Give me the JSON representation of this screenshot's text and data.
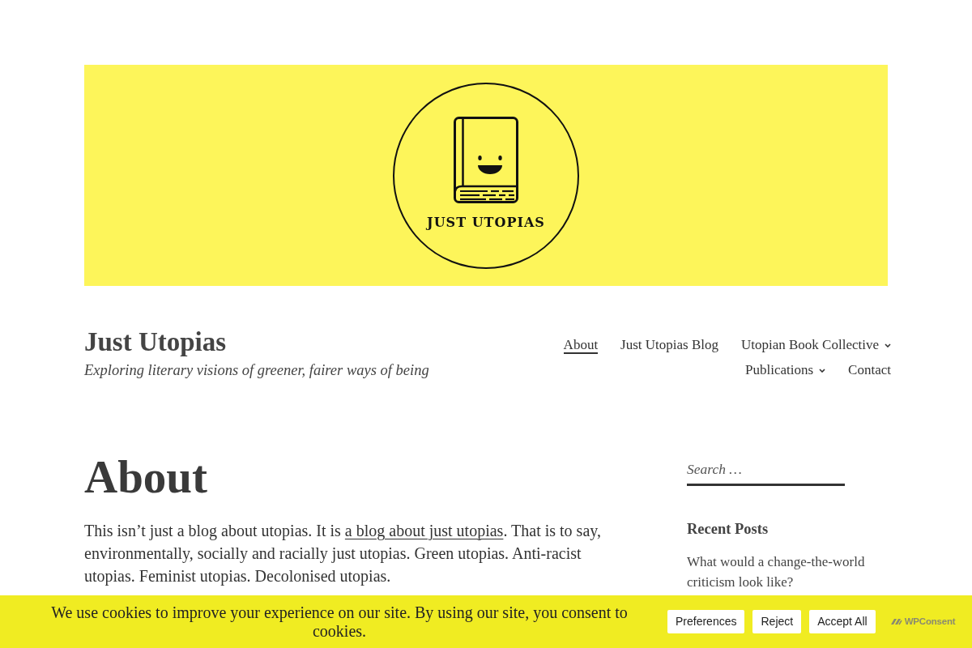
{
  "header_image": {
    "logo_text": "JUST UTOPIAS"
  },
  "site": {
    "title": "Just Utopias",
    "tagline": "Exploring literary visions of greener, fairer ways of being"
  },
  "nav": [
    {
      "label": "About",
      "selected": true,
      "has_submenu": false
    },
    {
      "label": "Just Utopias Blog",
      "selected": false,
      "has_submenu": false
    },
    {
      "label": "Utopian Book Collective",
      "selected": false,
      "has_submenu": true
    },
    {
      "label": "Publications",
      "selected": false,
      "has_submenu": true
    },
    {
      "label": "Contact",
      "selected": false,
      "has_submenu": false
    }
  ],
  "page": {
    "title": "About",
    "paragraph": [
      {
        "kind": "text",
        "text": "This isn’t just a blog about utopias. It is "
      },
      {
        "kind": "link",
        "text": "a blog about just utopias"
      },
      {
        "kind": "text",
        "text": ". That is to say, environmentally, socially and racially just utopias. Green utopias. Anti-racist utopias. Feminist utopias. Decolonised utopias."
      }
    ]
  },
  "sidebar": {
    "search": {
      "placeholder": "Search …"
    },
    "recent_posts": {
      "title": "Recent Posts",
      "items": [
        "What would a change-the-world criticism look like?"
      ]
    }
  },
  "cookie_banner": {
    "message": "We use cookies to improve your experience on our site. By using our site, you consent to cookies.",
    "buttons": [
      "Preferences",
      "Reject",
      "Accept All"
    ],
    "branding": "WPConsent"
  }
}
